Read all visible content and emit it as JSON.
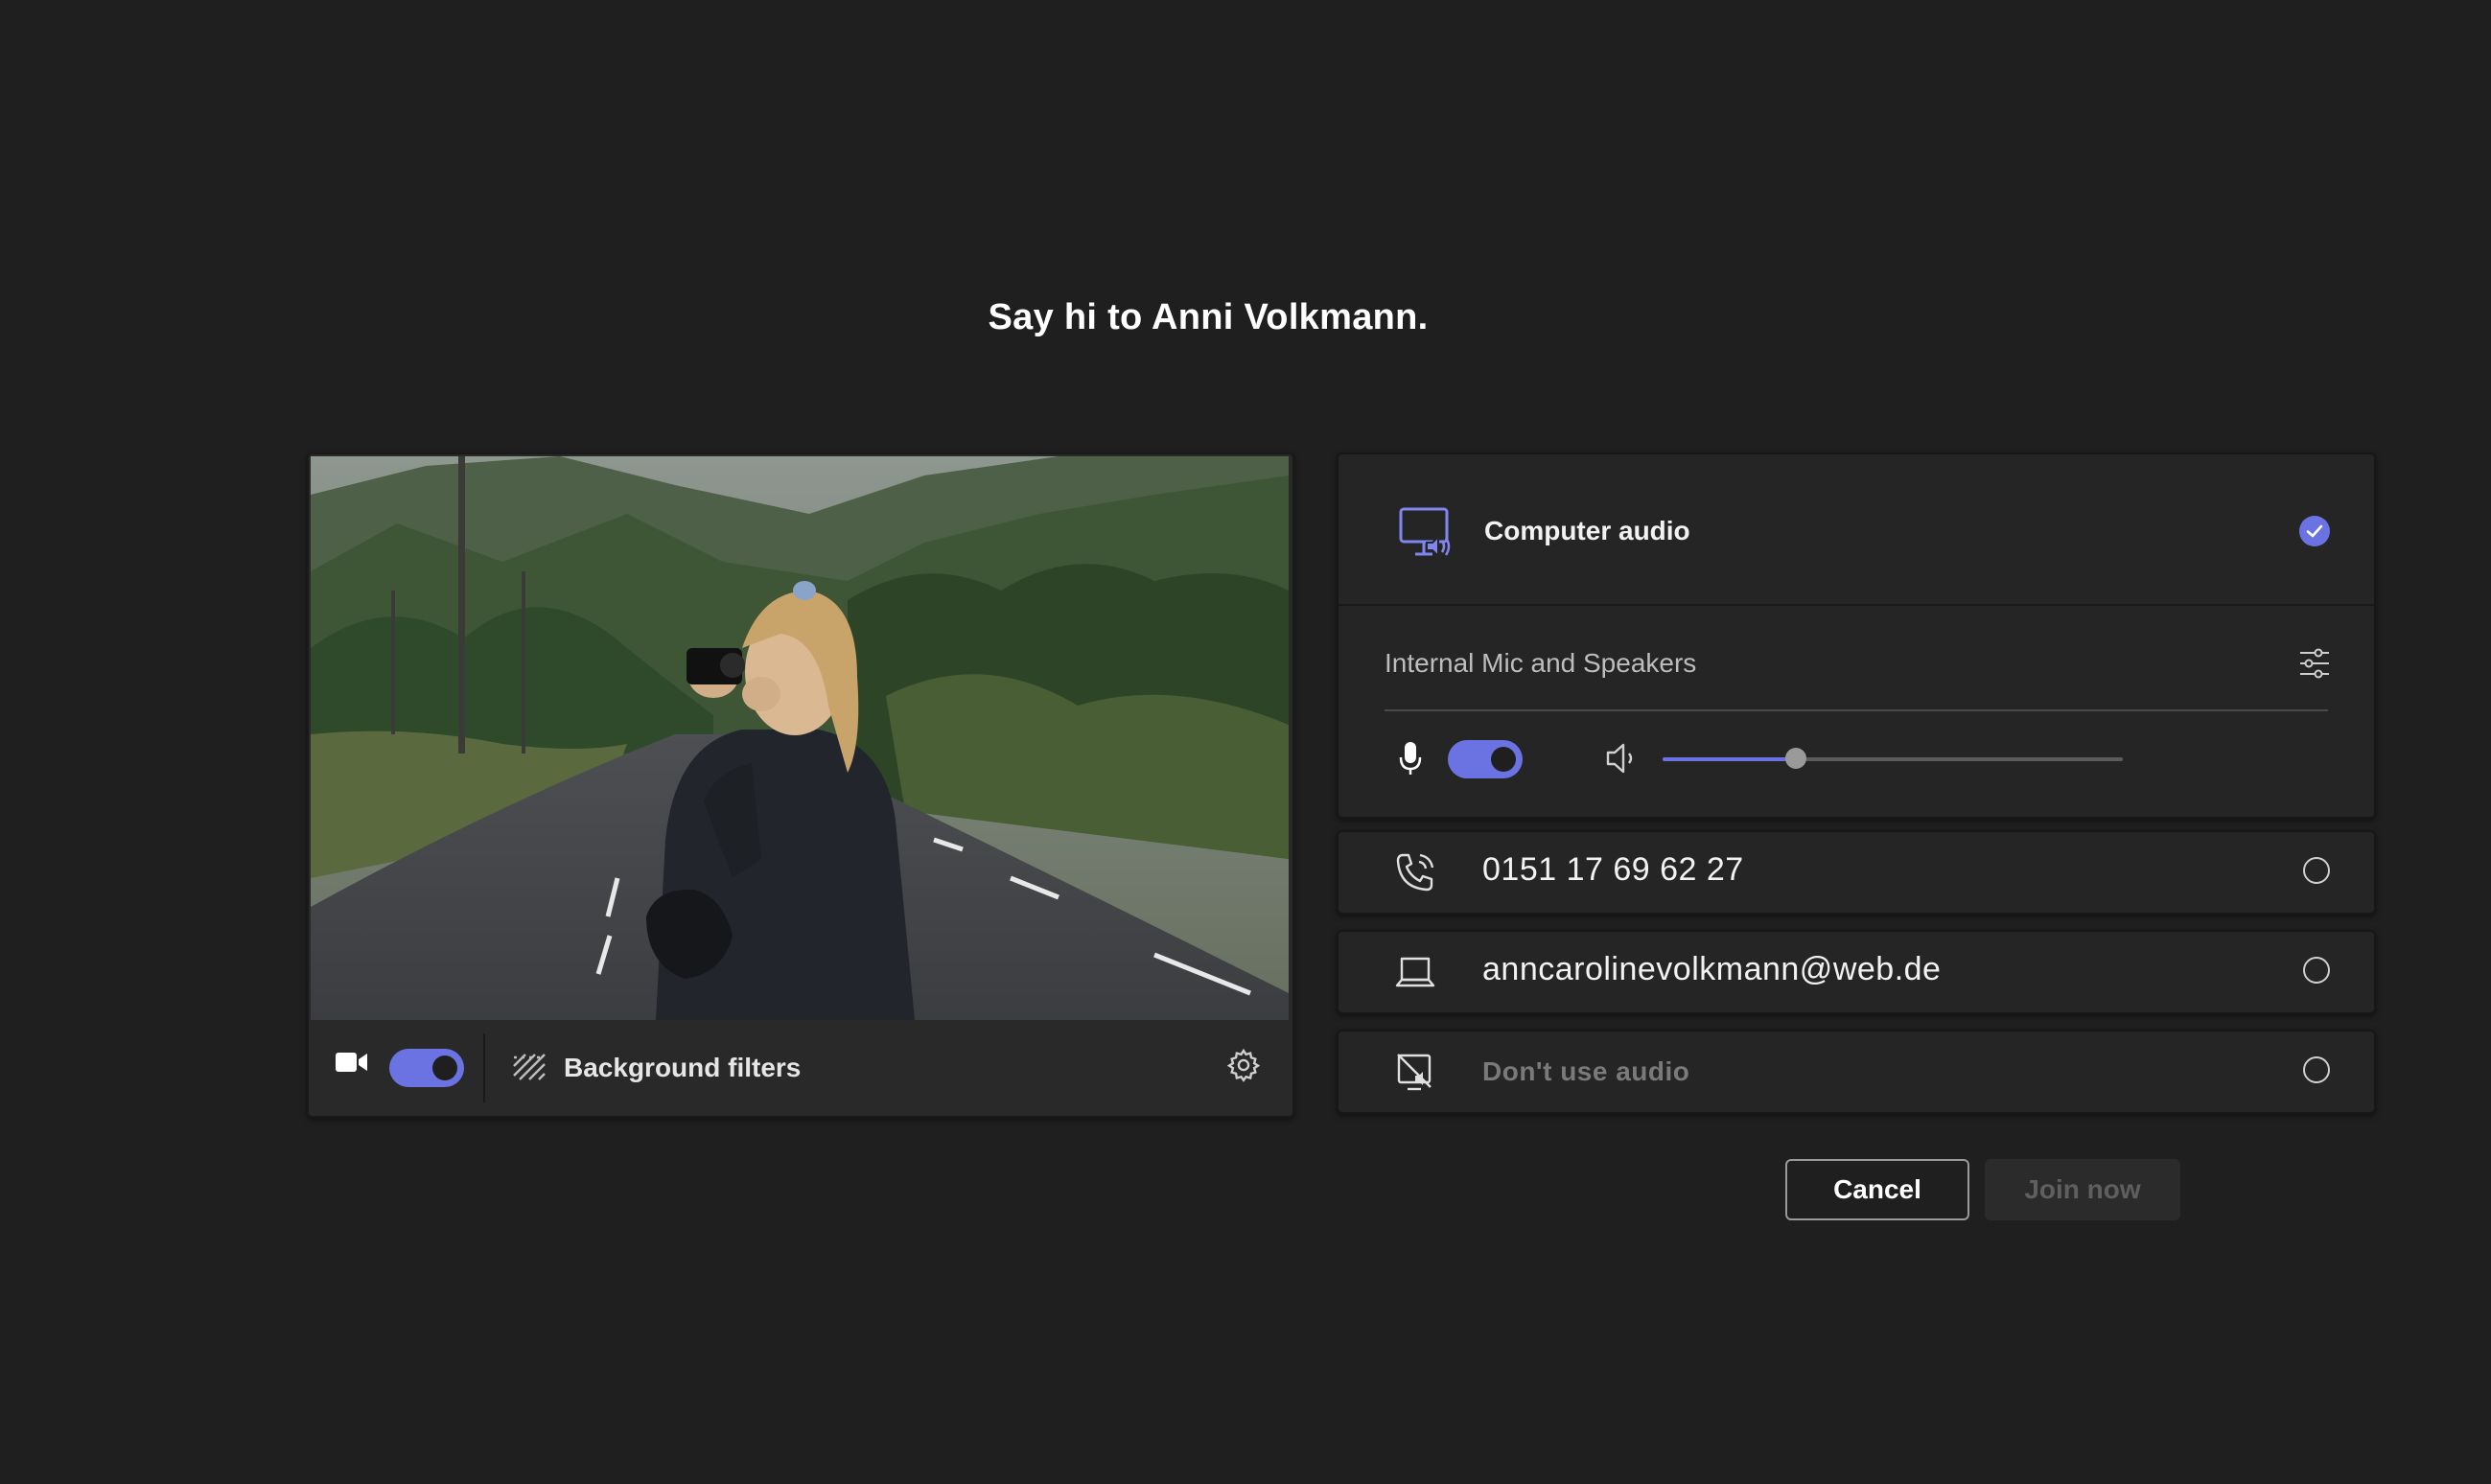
{
  "header": {
    "title": "Say hi to Anni Volkmann."
  },
  "video": {
    "camera_enabled": true,
    "background_filters_label": "Background filters"
  },
  "audio": {
    "computer_audio_label": "Computer audio",
    "computer_audio_selected": true,
    "device_name": "Internal Mic and Speakers",
    "mic_enabled": true,
    "speaker_volume": 0.29,
    "options": [
      {
        "label": "0151 17 69 62 27",
        "icon": "phone-call-icon",
        "selected": false
      },
      {
        "label": "anncarolinevolkmann@web.de",
        "icon": "laptop-icon",
        "selected": false
      },
      {
        "label": "Don't use audio",
        "icon": "no-audio-icon",
        "selected": false
      }
    ]
  },
  "actions": {
    "cancel_label": "Cancel",
    "join_label": "Join now"
  },
  "colors": {
    "accent": "#6b73e3",
    "background": "#1f1f1f",
    "card": "#252525"
  }
}
